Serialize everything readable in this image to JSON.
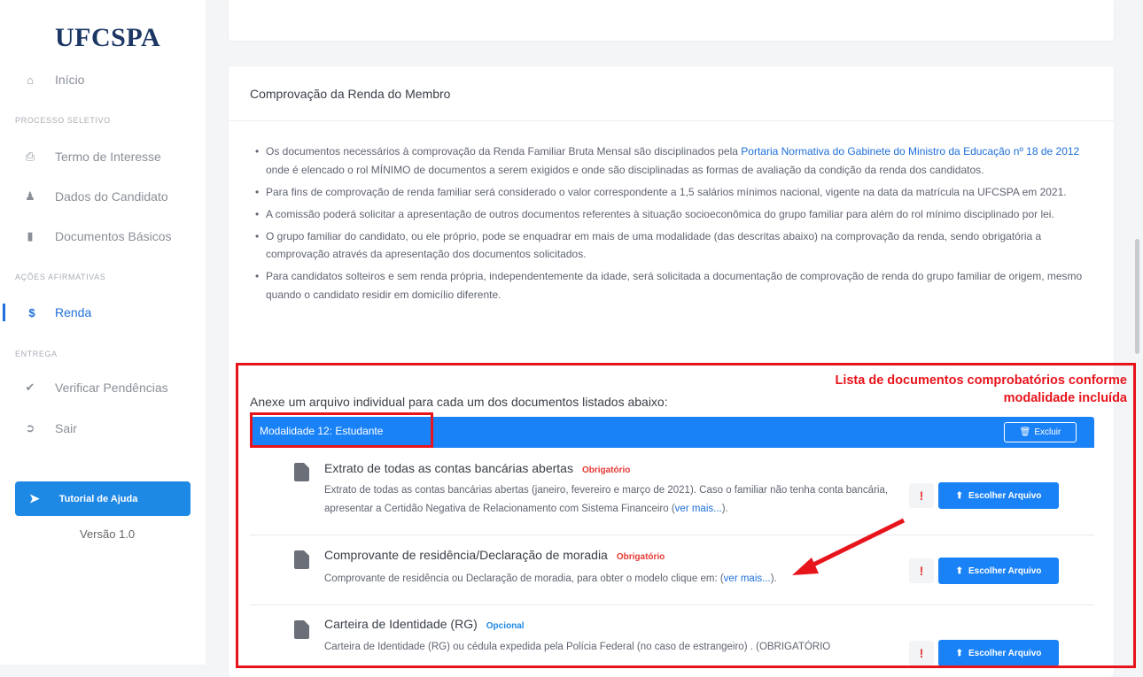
{
  "sidebar": {
    "logo": "UFCSPA",
    "home": "Início",
    "section_processo": "PROCESSO SELETIVO",
    "termo": "Termo de Interesse",
    "dados": "Dados do Candidato",
    "documentos": "Documentos Básicos",
    "section_acoes": "AÇÕES AFIRMATIVAS",
    "renda": "Renda",
    "section_entrega": "ENTREGA",
    "verificar": "Verificar Pendências",
    "sair": "Sair",
    "help": "Tutorial de Ajuda",
    "version": "Versão 1.0"
  },
  "card": {
    "title": "Comprovação da Renda do Membro",
    "b1_pre": "Os documentos necessários à comprovação da Renda Familiar Bruta Mensal são disciplinados pela ",
    "b1_link": "Portaria Normativa do Gabinete do Ministro da Educação nº 18 de 2012",
    "b1_post": " onde é elencado o rol MÍNIMO de documentos a serem exigidos e onde são disciplinadas as formas de avaliação da condição da renda dos candidatos.",
    "b2": "Para fins de comprovação de renda familiar será considerado o valor correspondente a 1,5 salários mínimos nacional, vigente na data da matrícula na UFCSPA em 2021.",
    "b3": "A comissão poderá solicitar a apresentação de outros documentos referentes à situação socioeconômica do grupo familiar para além do rol mínimo disciplinado por lei.",
    "b4": "O grupo familiar do candidato, ou ele próprio, pode se enquadrar em mais de uma modalidade (das descritas abaixo) na comprovação da renda, sendo obrigatória a comprovação através da apresentação dos documentos solicitados.",
    "b5": "Para candidatos solteiros e sem renda própria, independentemente da idade, será solicitada a documentação de comprovação de renda do grupo familiar de origem, mesmo quando o candidato residir em domicílio diferente.",
    "annex": "Anexe um arquivo individual para cada um dos documentos listados abaixo:",
    "modalidade": "Modalidade 12: Estudante",
    "excluir": "Excluir"
  },
  "docs": [
    {
      "title": "Extrato de todas as contas bancárias abertas",
      "badge": "Obrigatório",
      "desc": "Extrato de todas as contas bancárias abertas (janeiro, fevereiro e março de 2021). Caso o familiar não tenha conta bancária, apresentar a Certidão Negativa de Relacionamento com Sistema Financeiro (",
      "link": "ver mais...",
      "desc_end": ").",
      "button": "Escolher Arquivo"
    },
    {
      "title": "Comprovante de residência/Declaração de moradia",
      "badge": "Obrigatório",
      "desc": "Comprovante de residência ou Declaração de moradia, para obter o modelo clique em: (",
      "link": "ver mais...",
      "desc_end": ").",
      "button": "Escolher Arquivo"
    },
    {
      "title": "Carteira de Identidade (RG)",
      "badge": "Opcional",
      "desc": "Carteira de Identidade (RG) ou cédula expedida pela Polícia Federal (no caso de estrangeiro) . (OBRIGATÓRIO",
      "button": "Escolher Arquivo"
    }
  ],
  "annotation": {
    "line1": "Lista de documentos comprobatórios conforme",
    "line2": "modalidade incluída"
  },
  "colors": {
    "accent": "#1a82f7",
    "annotation": "#e8141c",
    "navy": "#1c3764"
  }
}
